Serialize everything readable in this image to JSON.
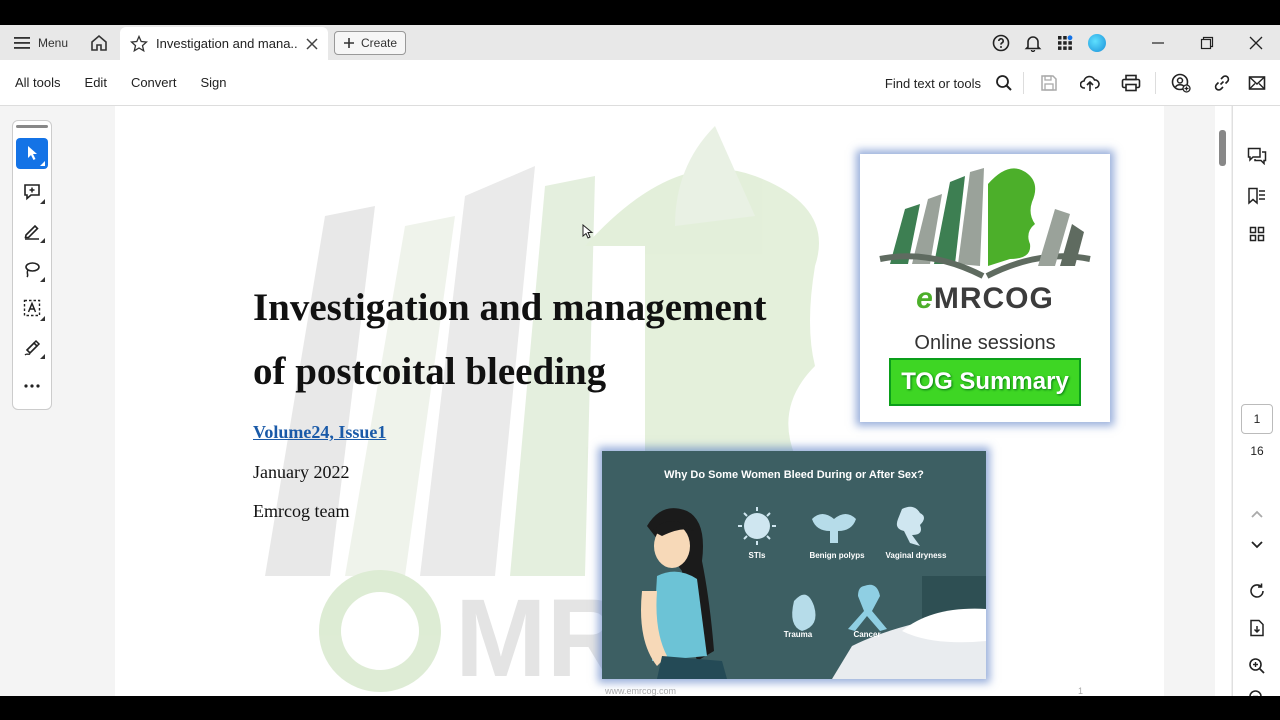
{
  "tabbar": {
    "menu_label": "Menu",
    "tab_title": "Investigation and mana...",
    "create_label": "Create"
  },
  "toolbar": {
    "items": [
      "All tools",
      "Edit",
      "Convert",
      "Sign"
    ],
    "find_label": "Find text or tools"
  },
  "document": {
    "title_line1": "Investigation and management",
    "title_line2": "of postcoital bleeding",
    "volume": "Volume24, Issue1",
    "date": "January 2022",
    "author": "Emrcog team",
    "footer_url": "www.emrcog.com",
    "footer_page": "1"
  },
  "logo_card": {
    "logo_e": "e",
    "logo_rest": "MRCOG",
    "subtitle": "Online sessions",
    "badge": "TOG Summary"
  },
  "info_card": {
    "title": "Why Do Some Women Bleed During or After Sex?",
    "labels": [
      "STIs",
      "Benign polyps",
      "Vaginal dryness",
      "Trauma",
      "Cancer"
    ]
  },
  "pagination": {
    "current": "1",
    "total": "16"
  },
  "colors": {
    "accent": "#1473e6",
    "brand_green": "#4caf2a",
    "badge_green": "#3ed624",
    "link_blue": "#1a5aa8"
  }
}
